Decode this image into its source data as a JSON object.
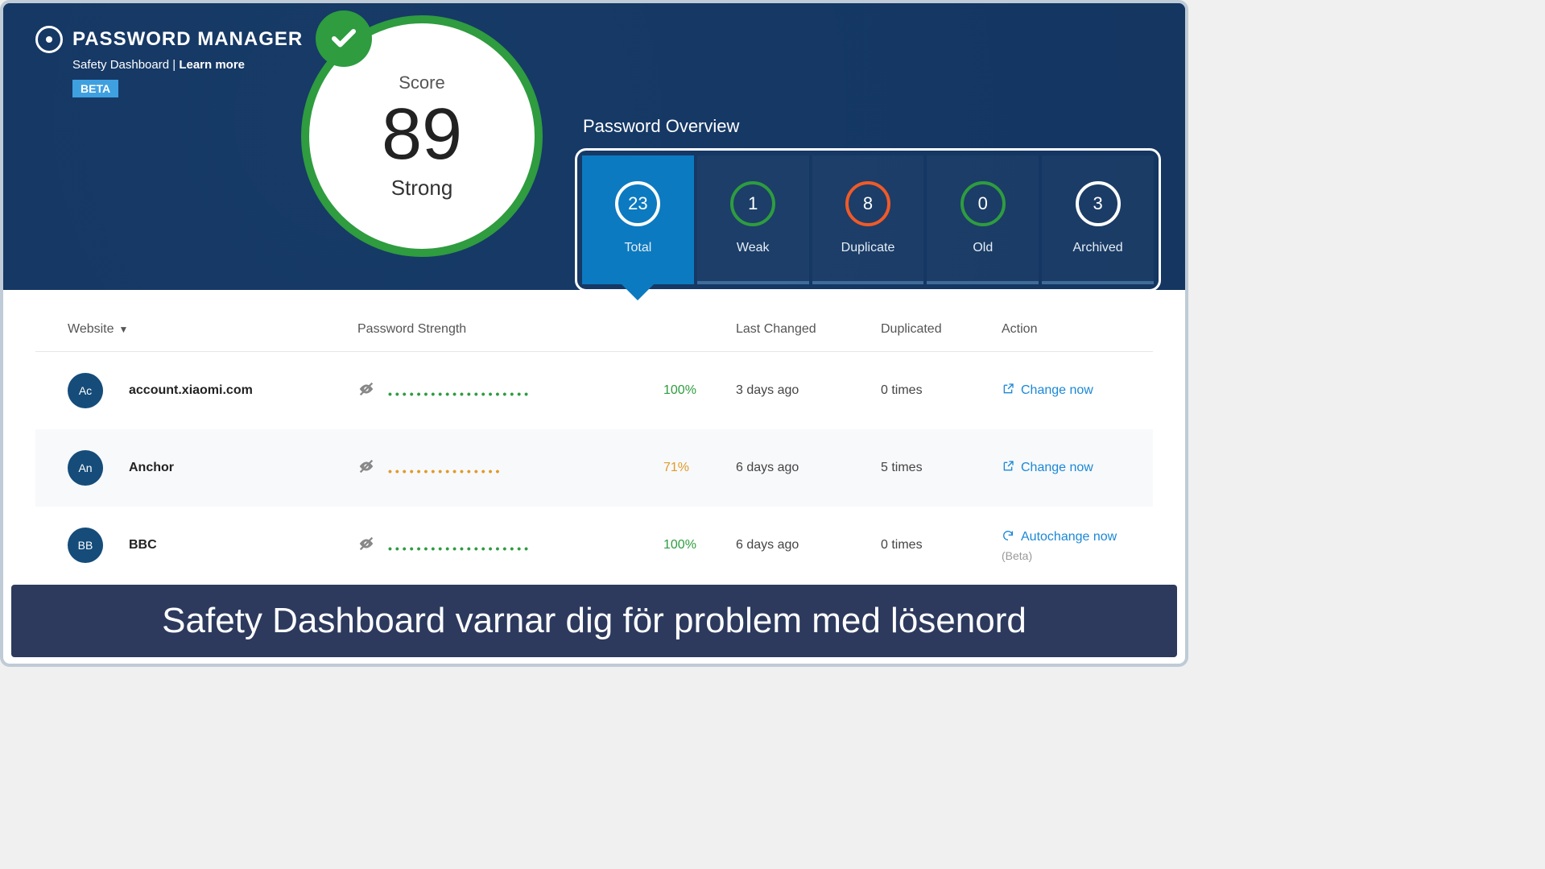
{
  "brand": {
    "title": "PASSWORD MANAGER",
    "subtitle_prefix": "Safety Dashboard | ",
    "learn_more": "Learn more",
    "beta": "BETA"
  },
  "score": {
    "label": "Score",
    "value": "89",
    "rating": "Strong"
  },
  "overview": {
    "title": "Password Overview",
    "tabs": [
      {
        "value": "23",
        "label": "Total",
        "circle": "white",
        "active": true
      },
      {
        "value": "1",
        "label": "Weak",
        "circle": "green",
        "active": false
      },
      {
        "value": "8",
        "label": "Duplicate",
        "circle": "orange",
        "active": false
      },
      {
        "value": "0",
        "label": "Old",
        "circle": "green",
        "active": false
      },
      {
        "value": "3",
        "label": "Archived",
        "circle": "white",
        "active": false
      }
    ]
  },
  "columns": {
    "website": "Website",
    "strength": "Password Strength",
    "changed": "Last Changed",
    "duplicated": "Duplicated",
    "action": "Action"
  },
  "rows": [
    {
      "avatar": "Ac",
      "site": "account.xiaomi.com",
      "dots": "••••••••••••••••••••",
      "dot_color": "green",
      "pct": "100%",
      "pct_color": "green",
      "changed": "3 days ago",
      "dup": "0 times",
      "action": "Change now",
      "action_icon": "external",
      "sub": "",
      "alt": false
    },
    {
      "avatar": "An",
      "site": "Anchor",
      "dots": "••••••••••••••••",
      "dot_color": "orange",
      "pct": "71%",
      "pct_color": "orange",
      "changed": "6 days ago",
      "dup": "5 times",
      "action": "Change now",
      "action_icon": "external",
      "sub": "",
      "alt": true
    },
    {
      "avatar": "BB",
      "site": "BBC",
      "dots": "••••••••••••••••••••",
      "dot_color": "green",
      "pct": "100%",
      "pct_color": "green",
      "changed": "6 days ago",
      "dup": "0 times",
      "action": "Autochange now",
      "action_icon": "refresh",
      "sub": "(Beta)",
      "alt": false
    }
  ],
  "caption": "Safety Dashboard varnar dig för problem med lösenord"
}
